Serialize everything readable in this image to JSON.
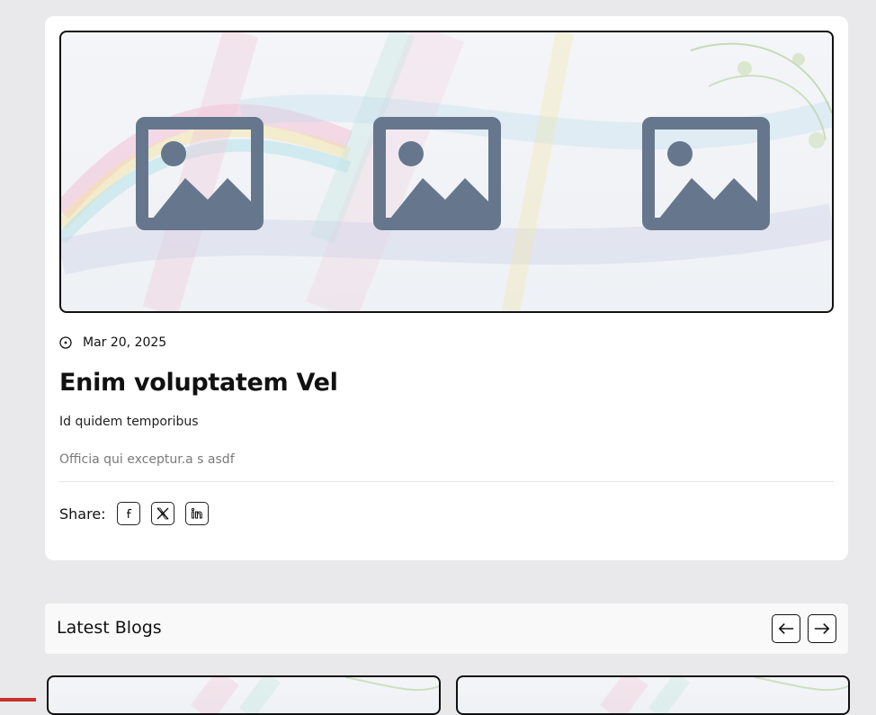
{
  "post": {
    "date": "Mar 20, 2025",
    "title": "Enim voluptatem Vel",
    "subtitle": "Id quidem temporibus",
    "excerpt": "Officia qui exceptur.a s asdf",
    "share_label": "Share:"
  },
  "share_buttons": [
    {
      "name": "facebook",
      "icon": "facebook-icon"
    },
    {
      "name": "x",
      "icon": "x-icon"
    },
    {
      "name": "linkedin",
      "icon": "linkedin-icon"
    }
  ],
  "latest": {
    "title": "Latest Blogs"
  },
  "colors": {
    "placeholder": "#66778d",
    "background": "#e9e8ea",
    "accent_red": "#c9302c"
  }
}
